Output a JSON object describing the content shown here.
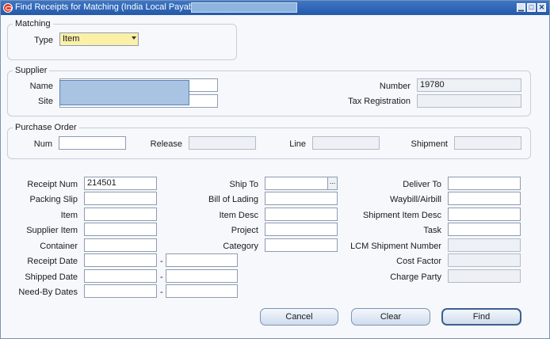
{
  "window": {
    "title": "Find Receipts for Matching (India Local Payables)",
    "min_glyph": "▁",
    "max_glyph": "□",
    "close_glyph": "✕"
  },
  "matching": {
    "group_title": "Matching",
    "type_label": "Type",
    "type_value": "Item"
  },
  "supplier": {
    "group_title": "Supplier",
    "name_label": "Name",
    "name_value": "",
    "site_label": "Site",
    "site_value": "",
    "number_label": "Number",
    "number_value": "19780",
    "tax_label": "Tax Registration",
    "tax_value": ""
  },
  "po": {
    "group_title": "Purchase Order",
    "num_label": "Num",
    "release_label": "Release",
    "line_label": "Line",
    "shipment_label": "Shipment"
  },
  "criteria": {
    "receipt_num_label": "Receipt Num",
    "receipt_num_value": "214501",
    "packing_slip_label": "Packing Slip",
    "item_label": "Item",
    "supplier_item_label": "Supplier Item",
    "container_label": "Container",
    "receipt_date_label": "Receipt Date",
    "shipped_date_label": "Shipped Date",
    "need_by_label": "Need-By Dates",
    "range_dash": "-",
    "ship_to_label": "Ship To",
    "lov_glyph": "...",
    "bol_label": "Bill of Lading",
    "item_desc_label": "Item Desc",
    "project_label": "Project",
    "category_label": "Category",
    "deliver_to_label": "Deliver To",
    "waybill_label": "Waybill/Airbill",
    "ship_item_desc_label": "Shipment Item Desc",
    "task_label": "Task",
    "lcm_label": "LCM Shipment Number",
    "cost_factor_label": "Cost Factor",
    "charge_party_label": "Charge Party"
  },
  "buttons": {
    "cancel": "Cancel",
    "clear": "Clear",
    "find": "Find"
  }
}
